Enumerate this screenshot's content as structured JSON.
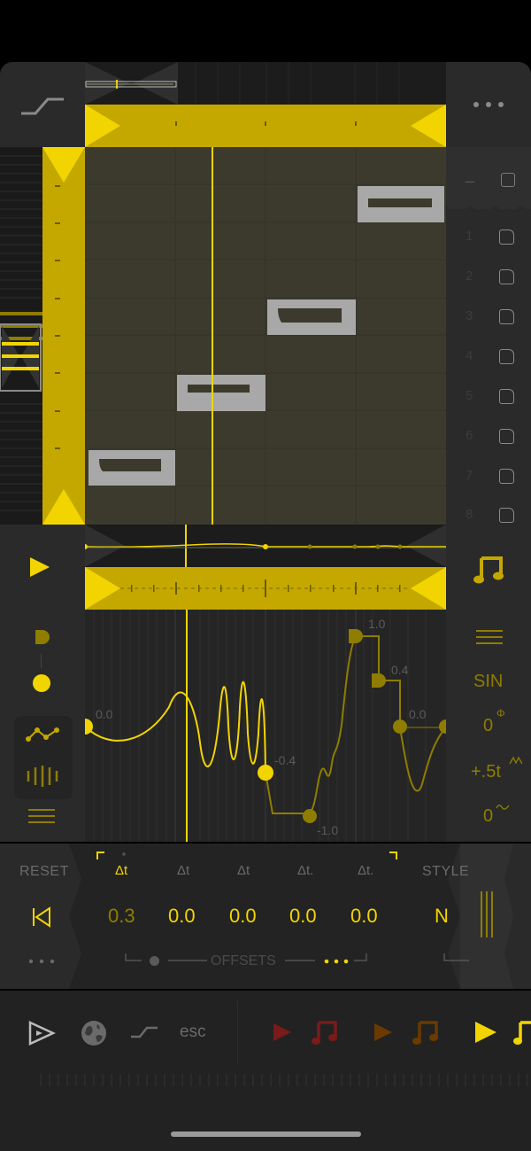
{
  "sequencer": {
    "slots": [
      "1",
      "2",
      "3",
      "4",
      "5",
      "6",
      "7",
      "8"
    ],
    "top_minus": "–"
  },
  "lfo": {
    "waveform": "SIN",
    "phase_value": "0",
    "phase_symbol": "Φ",
    "rate_value": "+.5t",
    "depth_value": "0",
    "point_labels": [
      "0.0",
      "-0.4",
      "-1.0",
      "1.0",
      "0.4",
      "0.0"
    ]
  },
  "offsets": {
    "reset_label": "RESET",
    "style_label": "STYLE",
    "style_value": "N",
    "title": "OFFSETS",
    "columns": [
      {
        "label": "Δt",
        "value": "0.3"
      },
      {
        "label": "Δt",
        "value": "0.0"
      },
      {
        "label": "Δt",
        "value": "0.0"
      },
      {
        "label": "Δt.",
        "value": "0.0"
      },
      {
        "label": "Δt.",
        "value": "0.0"
      }
    ]
  },
  "bottom_bar": {
    "esc_label": "esc"
  },
  "colors": {
    "accent": "#f2d500",
    "panel": "#2a2a2a",
    "background": "#000000"
  }
}
